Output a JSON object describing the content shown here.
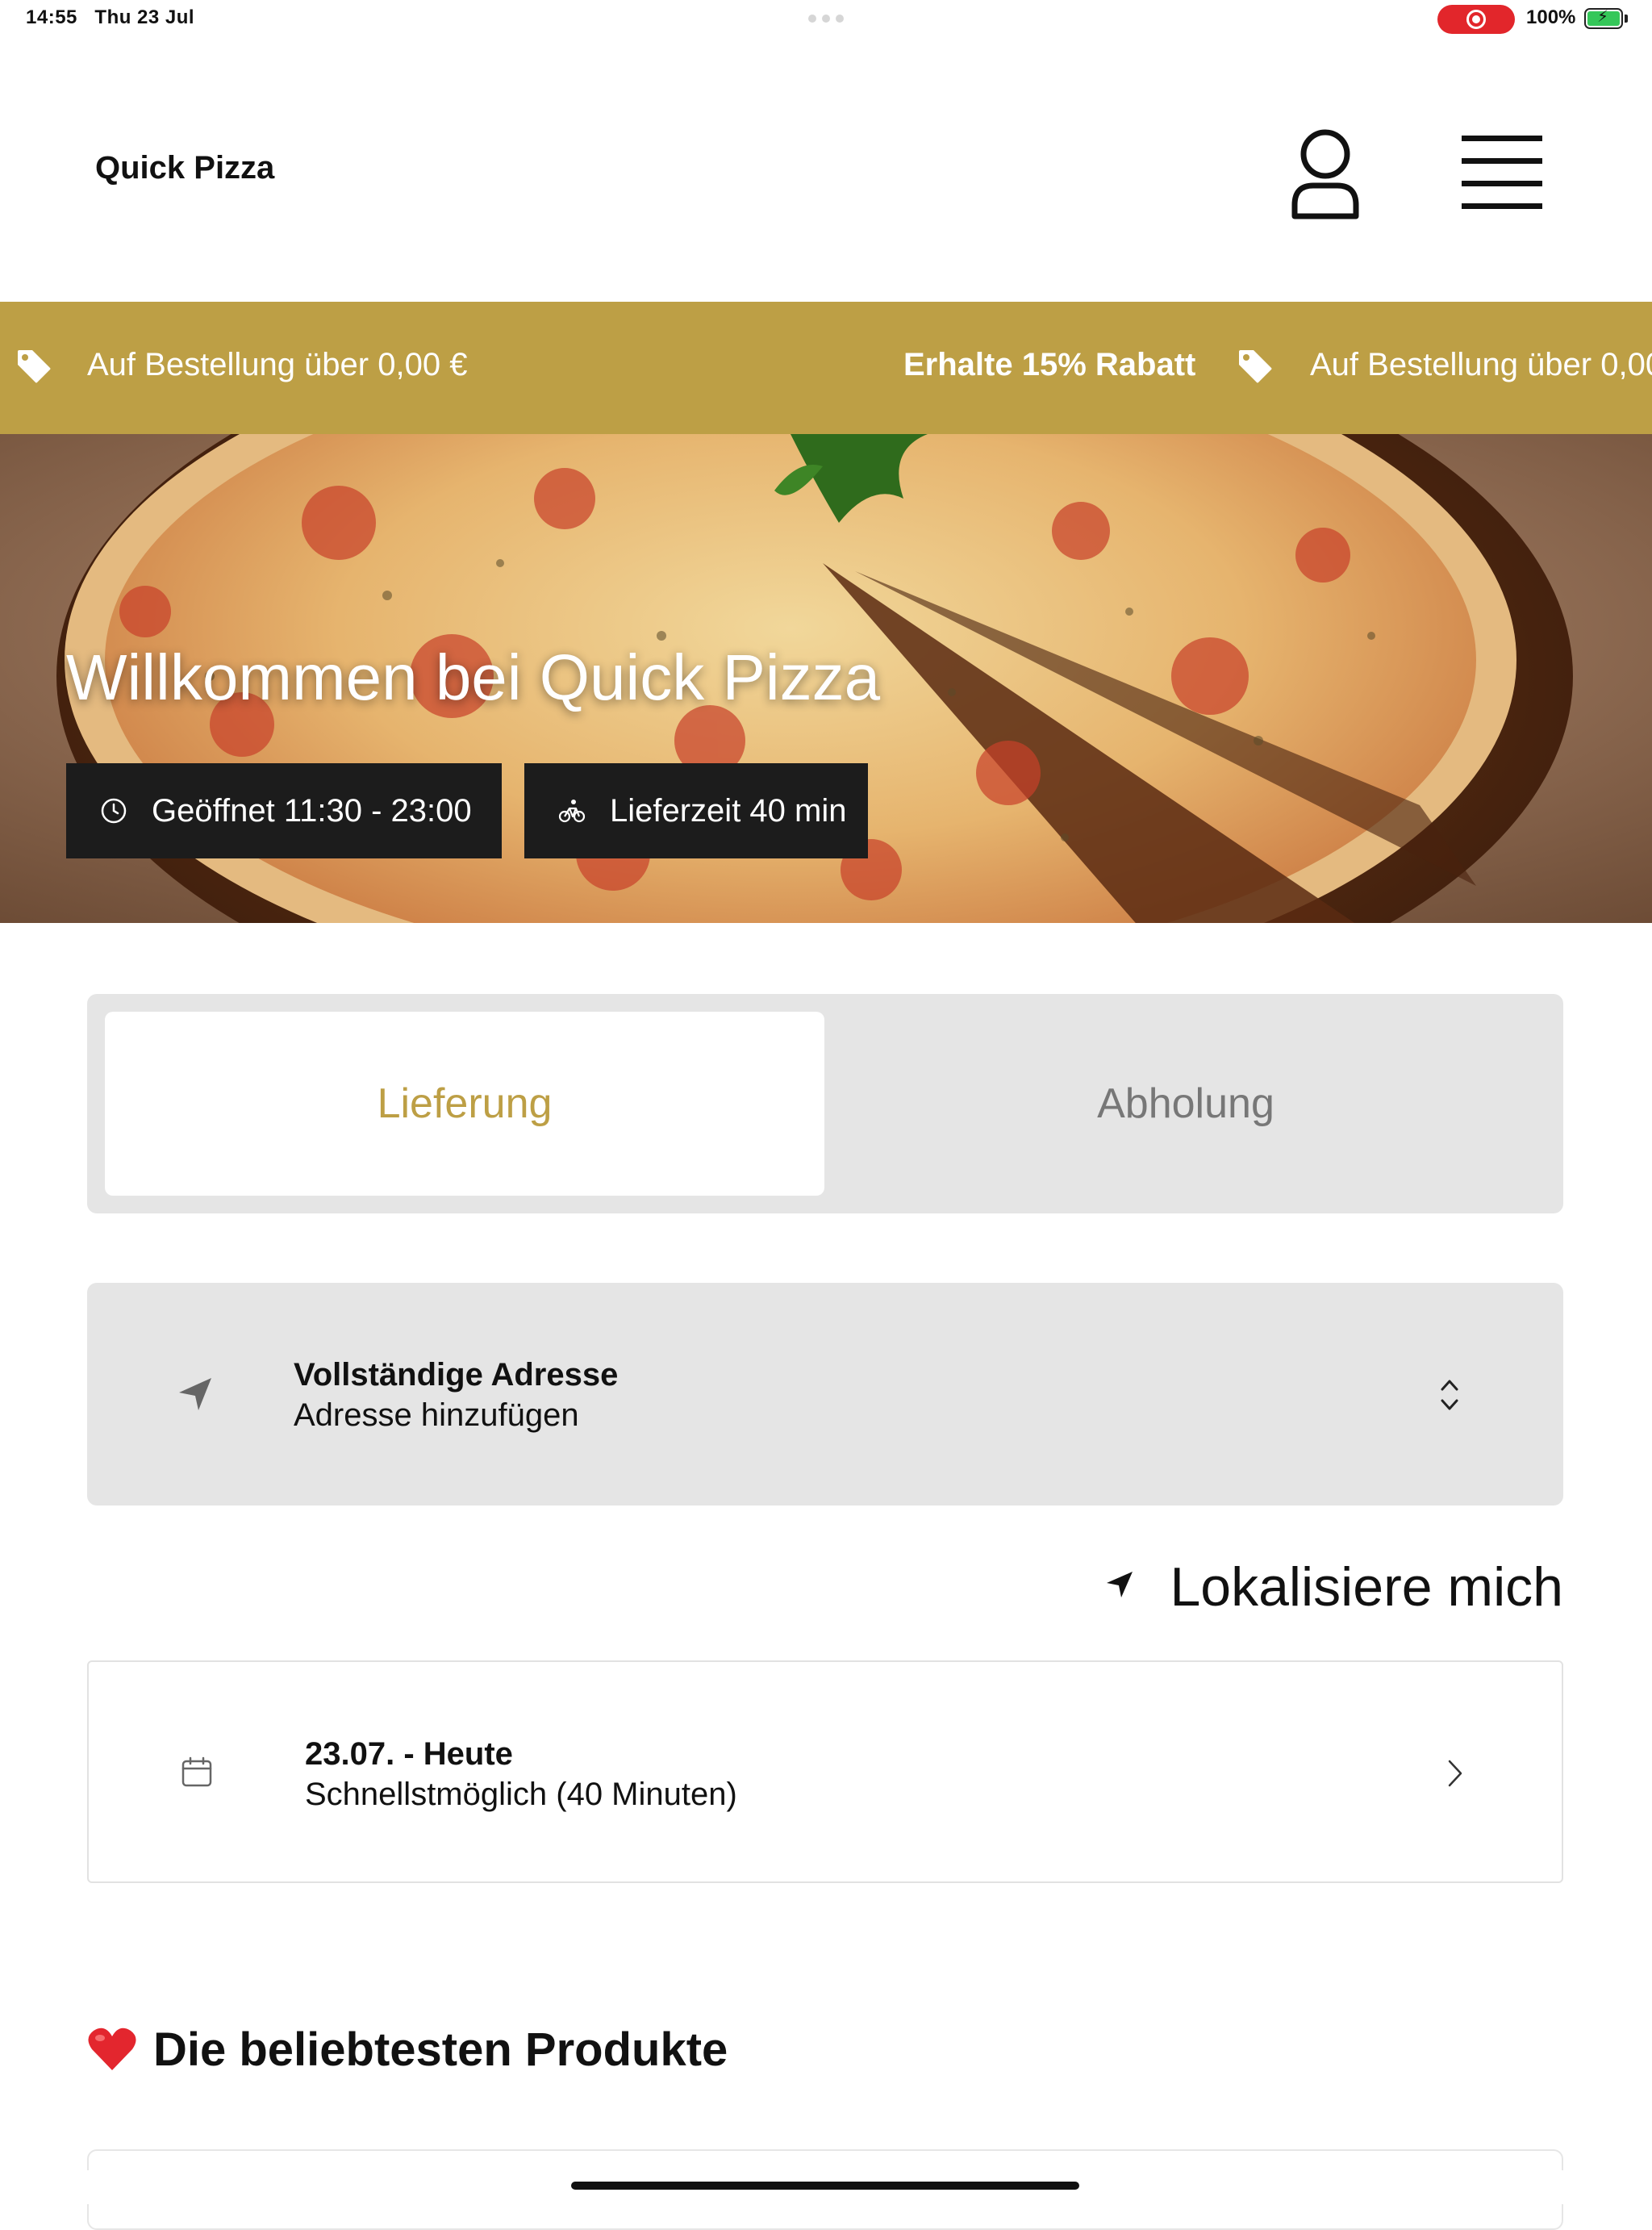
{
  "status_bar": {
    "time": "14:55",
    "date": "Thu 23 Jul",
    "battery": "100%",
    "recording_color": "#e2262b",
    "battery_color": "#35c759"
  },
  "header": {
    "brand": "Quick Pizza",
    "user_icon": "user-icon",
    "menu_icon": "hamburger-menu-icon"
  },
  "promo": {
    "background": "#bd9f45",
    "first_text": "Auf Bestellung über 0,00 €",
    "highlight": "Erhalte 15% Rabatt",
    "repeat_text": "Auf Bestellung über 0,00",
    "icon": "tag-icon"
  },
  "hero": {
    "title": "Willkommen bei Quick Pizza",
    "hours": "Geöffnet 11:30 - 23:00",
    "delivery_time": "Lieferzeit 40 min",
    "hours_icon": "clock-icon",
    "delivery_icon": "bicycle-icon"
  },
  "mode_tabs": {
    "delivery": "Lieferung",
    "pickup": "Abholung",
    "selected": "Lieferung",
    "accent": "#bd9f45"
  },
  "address": {
    "title": "Vollständige Adresse",
    "placeholder": "Adresse hinzufügen",
    "icon": "location-arrow-icon",
    "select_icon": "chevron-up-down-icon"
  },
  "locate": {
    "label": "Lokalisiere mich",
    "icon": "location-arrow-icon"
  },
  "schedule": {
    "date": "23.07. - Heute",
    "time": "Schnellstmöglich (40 Minuten)",
    "icon": "calendar-icon",
    "chevron": "chevron-right-icon"
  },
  "popular": {
    "title": "Die beliebtesten Produkte",
    "icon": "heart-icon"
  }
}
